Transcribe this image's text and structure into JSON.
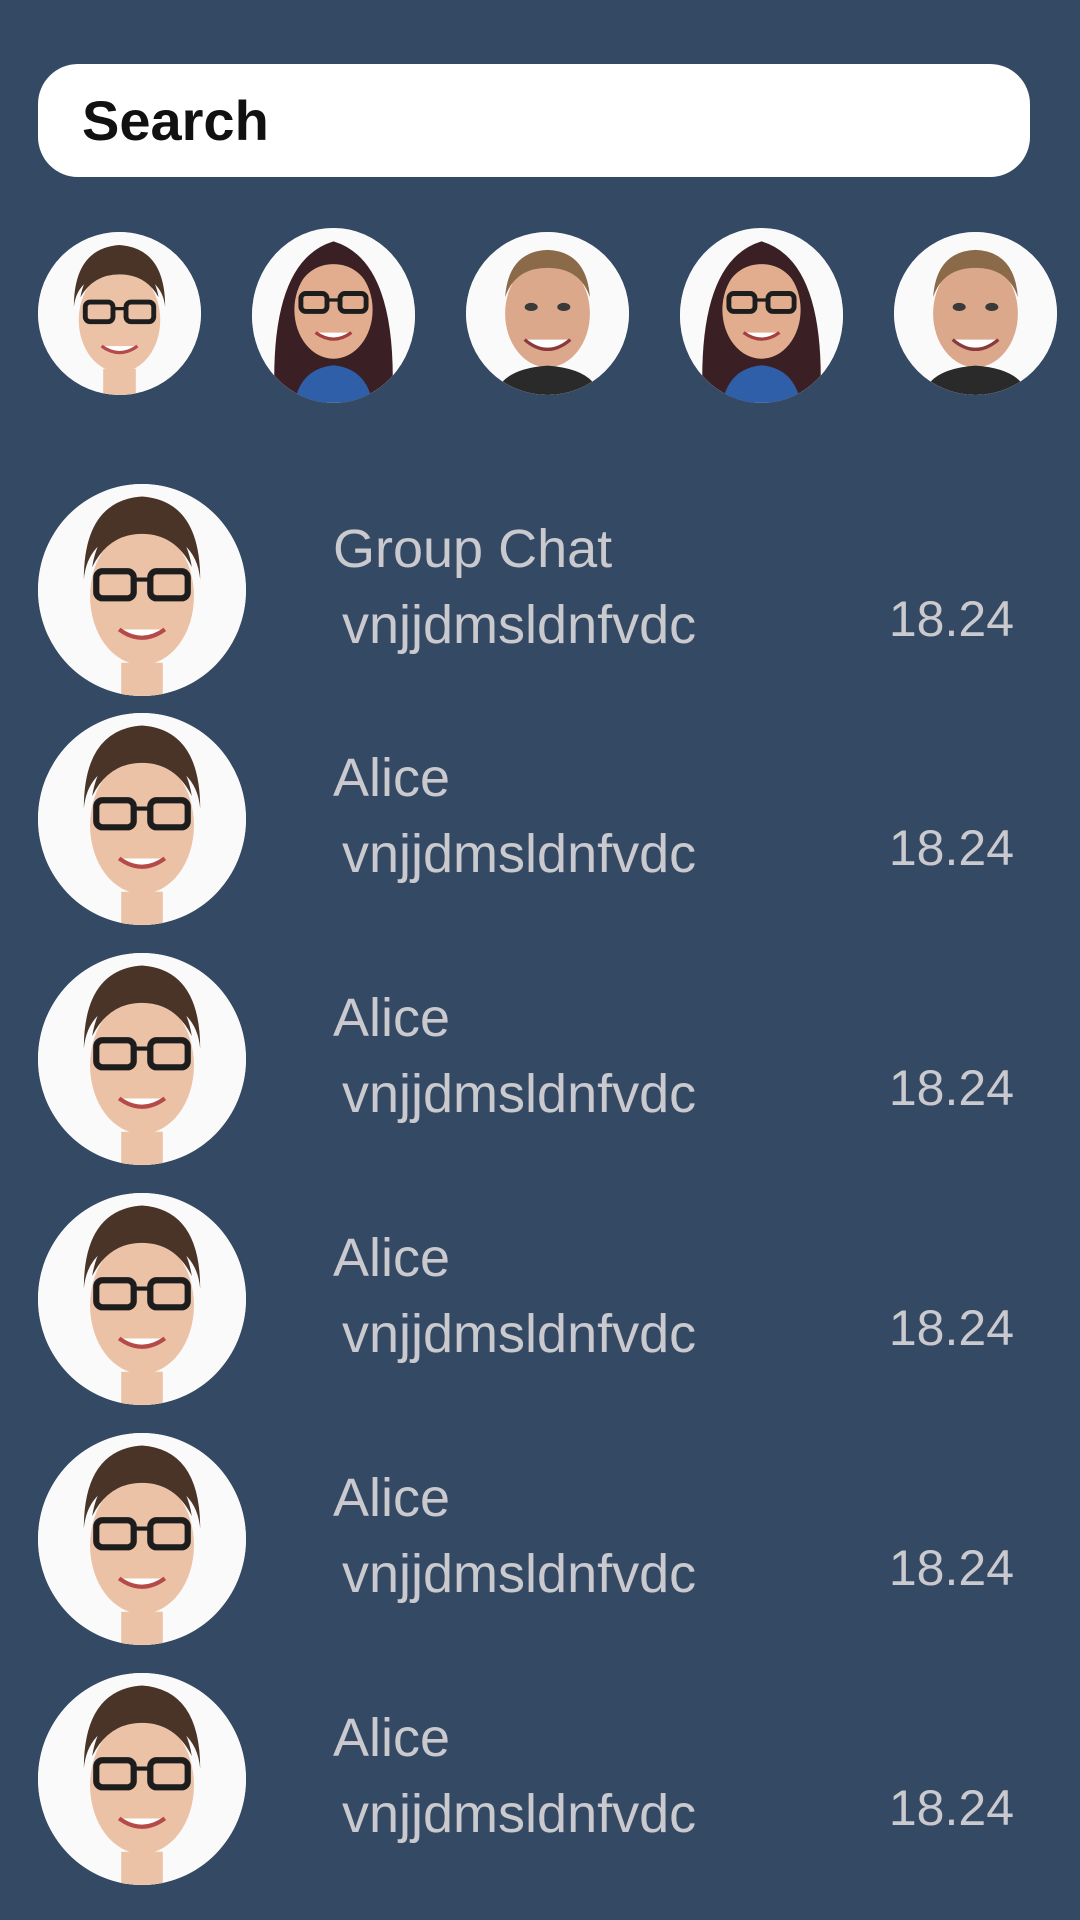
{
  "search": {
    "placeholder": "Search"
  },
  "stories": [
    {
      "avatar": "woman-glasses-avatar"
    },
    {
      "avatar": "woman-dark-hair-glasses-avatar"
    },
    {
      "avatar": "man-smiling-avatar"
    },
    {
      "avatar": "woman-dark-hair-glasses-avatar"
    },
    {
      "avatar": "man-smiling-avatar"
    }
  ],
  "chats": [
    {
      "name": "Group Chat",
      "message": "vnjjdmsldnfvdc",
      "time": "18.24",
      "avatar": "woman-glasses-avatar"
    },
    {
      "name": "Alice",
      "message": "vnjjdmsldnfvdc",
      "time": "18.24",
      "avatar": "woman-glasses-avatar"
    },
    {
      "name": "Alice",
      "message": "vnjjdmsldnfvdc",
      "time": "18.24",
      "avatar": "woman-glasses-avatar"
    },
    {
      "name": "Alice",
      "message": "vnjjdmsldnfvdc",
      "time": "18.24",
      "avatar": "woman-glasses-avatar"
    },
    {
      "name": "Alice",
      "message": "vnjjdmsldnfvdc",
      "time": "18.24",
      "avatar": "woman-glasses-avatar"
    },
    {
      "name": "Alice",
      "message": "vnjjdmsldnfvdc",
      "time": "18.24",
      "avatar": "woman-glasses-avatar"
    }
  ],
  "colors": {
    "background": "#344964",
    "text": "#c9c9ce",
    "search_bg": "#ffffff"
  }
}
